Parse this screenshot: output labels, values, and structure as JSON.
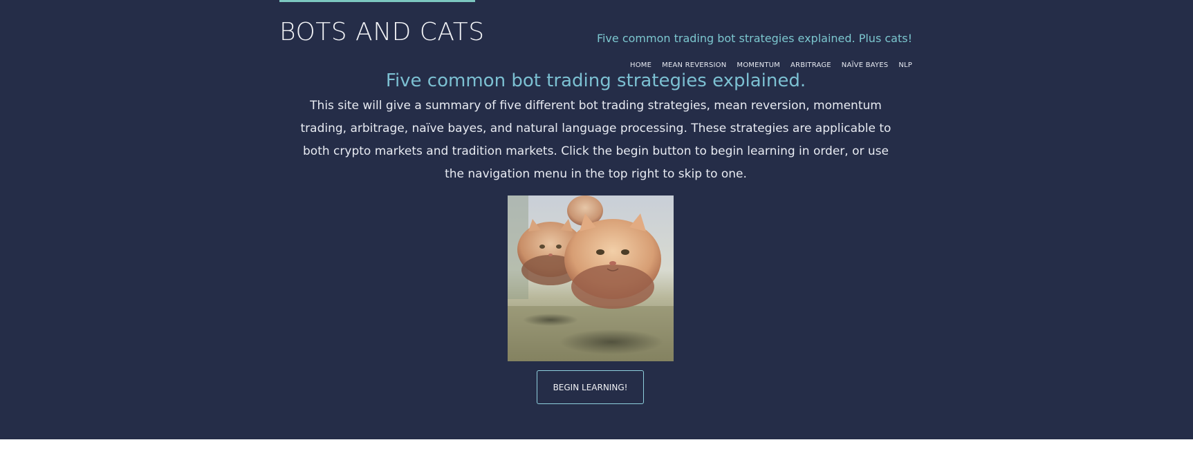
{
  "header": {
    "site_title": "BOTS AND CATS",
    "tagline": "Five common trading bot strategies explained. Plus cats!",
    "accent_color": "#7cc7c0"
  },
  "nav": {
    "items": [
      {
        "label": "HOME"
      },
      {
        "label": "MEAN REVERSION"
      },
      {
        "label": "MOMENTUM"
      },
      {
        "label": "ARBITRAGE"
      },
      {
        "label": "NAÏVE BAYES"
      },
      {
        "label": "NLP"
      }
    ]
  },
  "main": {
    "heading": "Five common bot trading strategies explained.",
    "intro": "This site will give a summary of five different bot trading strategies, mean reversion, momentum trading, arbitrage, naïve bayes, and natural language processing. These strategies are applicable to both crypto markets and tradition markets. Click the begin button to begin learning in order, or use the navigation menu in the top right to skip to one.",
    "image_icon": "flying-cats-image",
    "begin_button": "BEGIN LEARNING!"
  },
  "colors": {
    "background": "#252d48",
    "heading": "#7cc0d2",
    "text": "#e8ebf2",
    "button_border": "#8fd0de"
  }
}
